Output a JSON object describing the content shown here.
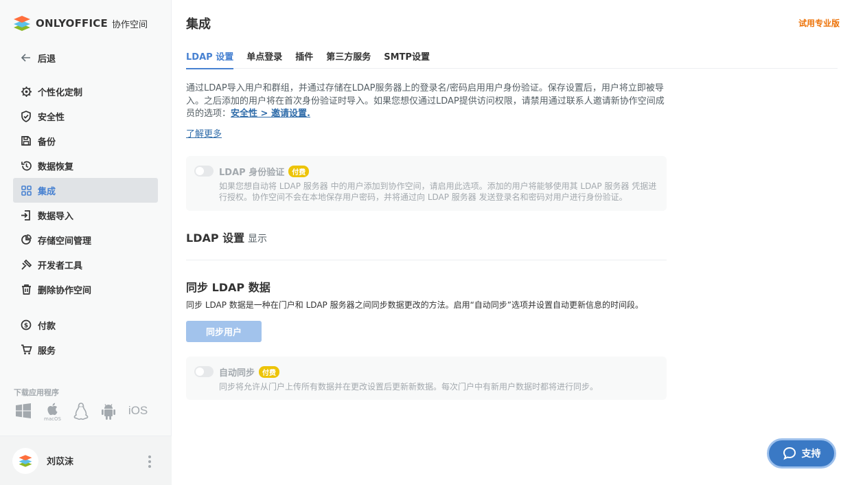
{
  "brand": {
    "name": "ONLYOFFICE",
    "sub": "协作空间"
  },
  "sidebar": {
    "back": "后退",
    "items": [
      {
        "label": "个性化定制",
        "icon": "gear-icon"
      },
      {
        "label": "安全性",
        "icon": "shield-icon"
      },
      {
        "label": "备份",
        "icon": "floppy-icon"
      },
      {
        "label": "数据恢复",
        "icon": "restore-icon"
      },
      {
        "label": "集成",
        "icon": "grid-icon",
        "active": true
      },
      {
        "label": "数据导入",
        "icon": "import-icon"
      },
      {
        "label": "存储空间管理",
        "icon": "pie-icon"
      },
      {
        "label": "开发者工具",
        "icon": "tools-icon"
      },
      {
        "label": "删除协作空间",
        "icon": "trash-icon"
      },
      {
        "label": "付款",
        "icon": "coin-icon"
      },
      {
        "label": "服务",
        "icon": "cart-icon"
      }
    ],
    "download_label": "下载应用程序",
    "apps": {
      "macos": "macOS",
      "ios": "iOS"
    }
  },
  "profile": {
    "name": "刘苡沫"
  },
  "header": {
    "title": "集成",
    "trial": "试用专业版"
  },
  "tabs": [
    "LDAP 设置",
    "单点登录",
    "插件",
    "第三方服务",
    "SMTP设置"
  ],
  "description": {
    "text": "通过LDAP导入用户和群组，并通过存储在LDAP服务器上的登录名/密码启用用户身份验证。保存设置后，用户将立即被导入。之后添加的用户将在首次身份验证时导入。如果您想仅通过LDAP提供访问权限，请禁用通过联系人邀请新协作空间成员的选项：",
    "link": "安全性 > 邀请设置.",
    "learn_more": "了解更多"
  },
  "ldap_auth": {
    "title": "LDAP 身份验证",
    "badge": "付费",
    "desc": "如果您想自动将 LDAP 服务器 中的用户添加到协作空间，请启用此选项。添加的用户将能够使用其 LDAP 服务器 凭据进行授权。协作空间不会在本地保存用户密码，并将通过向 LDAP 服务器 发送登录名和密码对用户进行身份验证。"
  },
  "ldap_settings": {
    "title": "LDAP 设置",
    "show": "显示"
  },
  "sync": {
    "title": "同步 LDAP 数据",
    "desc": "同步 LDAP 数据是一种在门户和 LDAP 服务器之间同步数据更改的方法。启用“自动同步”选项并设置自动更新信息的时间段。",
    "button": "同步用户"
  },
  "auto_sync": {
    "title": "自动同步",
    "badge": "付费",
    "desc": "同步将允许从门户上传所有数据并在更改设置后更新新数据。每次门户中有新用户数据时都将进行同步。"
  },
  "support": {
    "label": "支持"
  },
  "colors": {
    "accent": "#4781d1",
    "trial": "#ed7309",
    "badge": "#edc409",
    "support": "#3a79c5"
  }
}
